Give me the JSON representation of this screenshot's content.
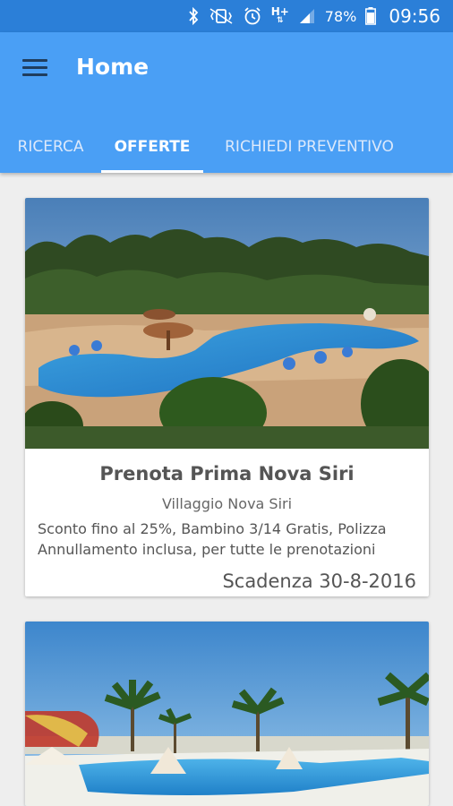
{
  "status_bar": {
    "battery": "78%",
    "time": "09:56",
    "network": "H+",
    "icons": [
      "bluetooth-icon",
      "vibrate-icon",
      "alarm-icon",
      "network-icon",
      "signal-icon",
      "battery-icon"
    ]
  },
  "app_bar": {
    "title": "Home",
    "menu_icon": "menu-icon"
  },
  "tabs": [
    {
      "label": "RICERCA",
      "active": false
    },
    {
      "label": "OFFERTE",
      "active": true
    },
    {
      "label": "RICHIEDI PREVENTIVO",
      "active": false
    }
  ],
  "offers": [
    {
      "title": "Prenota Prima Nova Siri",
      "subtitle": "Villaggio Nova Siri",
      "description": "Sconto fino al 25%, Bambino 3/14 Gratis, Polizza Annullamento inclusa, per tutte le prenotazioni",
      "deadline": "Scadenza 30-8-2016"
    },
    {
      "title": "",
      "subtitle": "",
      "description": "",
      "deadline": ""
    }
  ],
  "colors": {
    "status_bar": "#2b7fd8",
    "app_bar": "#4a9ff5",
    "background": "#eeeeee"
  }
}
